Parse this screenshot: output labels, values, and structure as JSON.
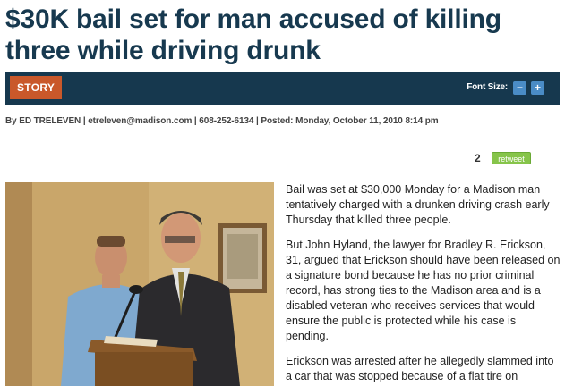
{
  "headline": "$30K bail set for man accused of killing three while driving drunk",
  "toolbar": {
    "story_tab": "STORY",
    "font_size_label": "Font Size:",
    "decrease_label": "−",
    "increase_label": "+"
  },
  "byline": "By ED TRELEVEN | etreleven@madison.com | 608-252-6134 | Posted: Monday, October 11, 2010 8:14 pm",
  "social": {
    "retweet_count": "2",
    "retweet_label": "retweet"
  },
  "article": {
    "paragraphs": [
      "Bail was set at $30,000 Monday for a Madison man tentatively charged with a drunken driving crash early Thursday that killed three people.",
      "But John Hyland, the lawyer for Bradley R. Erickson, 31, argued that Erickson should have been released on a signature bond because he has no prior criminal record, has strong ties to the Madison area and is a disabled veteran who receives services that would ensure the public is protected while his case is pending.",
      "Erickson was arrested after he allegedly slammed into a car that was stopped because of a flat tire on"
    ]
  },
  "colors": {
    "headline": "#17394f",
    "toolbar_bg": "#16384e",
    "story_tab": "#c9582a",
    "font_buttons": "#4a8cc6",
    "retweet": "#86c44a"
  }
}
